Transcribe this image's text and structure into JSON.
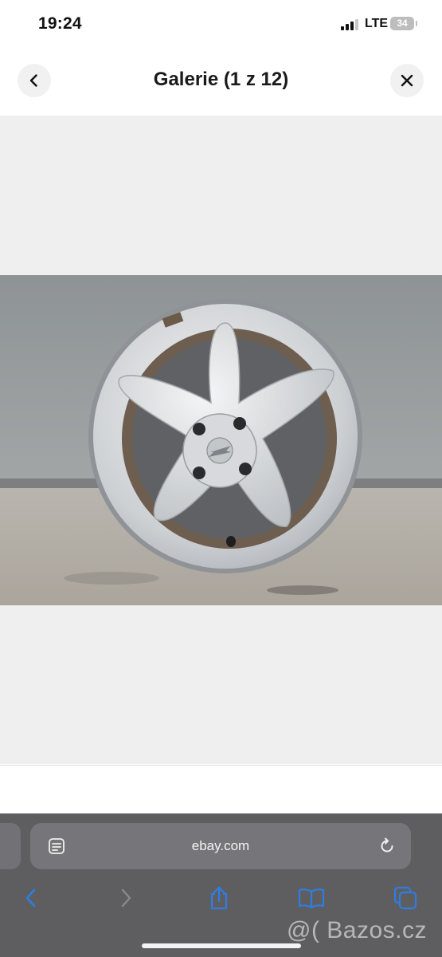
{
  "status_bar": {
    "time": "19:24",
    "network": "LTE",
    "battery": "34",
    "signal_bars": 3
  },
  "header": {
    "title": "Galerie (1 z 12)",
    "back_icon": "chevron-left-icon",
    "close_icon": "close-icon"
  },
  "gallery": {
    "current_index": 1,
    "total": 12,
    "image_description_icon": "alloy-wheel-photo"
  },
  "browser": {
    "url": "ebay.com",
    "page_menu_icon": "page-menu-icon",
    "reload_icon": "reload-icon",
    "toolbar": [
      "back-icon",
      "forward-icon",
      "share-icon",
      "bookmarks-icon",
      "tabs-icon"
    ],
    "accent_color": "#2f7de1"
  },
  "watermark": "@( Bazos.cz"
}
